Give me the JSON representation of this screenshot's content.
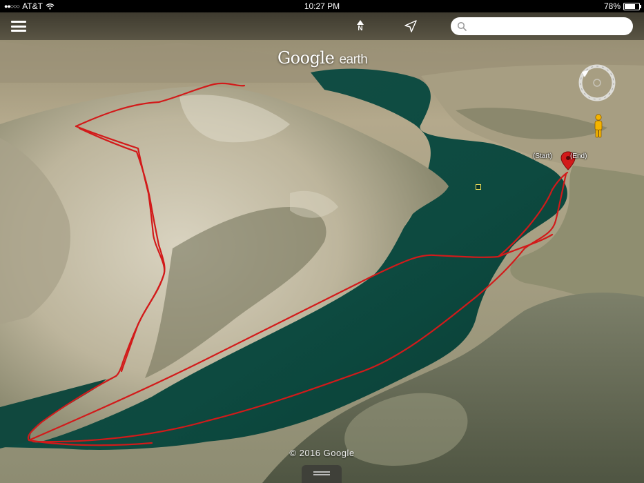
{
  "status_bar": {
    "carrier": "AT&T",
    "time": "10:27 PM",
    "battery_percent": "78%",
    "battery_level": 0.78
  },
  "toolbar": {
    "menu_icon": "hamburger-menu-icon",
    "north_label": "N",
    "locate_icon": "location-arrow-icon",
    "search_placeholder": "",
    "search_value": ""
  },
  "brand": {
    "name": "Google",
    "sub": "earth"
  },
  "track": {
    "start_label": "(Start)",
    "end_label": "(End)",
    "color": "#d21a1a"
  },
  "copyright": "© 2016 Google",
  "colors": {
    "lake": "#0f4f43",
    "terrain_light": "#cfc6b0",
    "terrain_dark": "#5c6048",
    "accent": "#d21a1a"
  }
}
